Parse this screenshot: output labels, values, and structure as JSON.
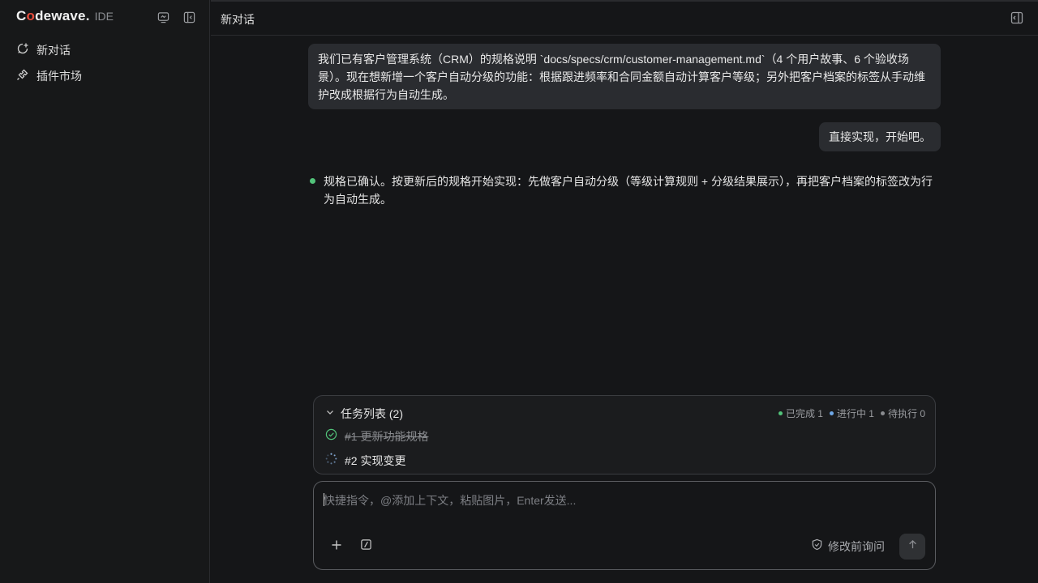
{
  "app": {
    "logo_text_pre": "C",
    "logo_text_o": "o",
    "logo_text_post": "dewave.",
    "logo_suffix": "IDE"
  },
  "sidebar": {
    "items": [
      {
        "label": "新对话",
        "icon": "new-chat-icon"
      },
      {
        "label": "插件市场",
        "icon": "plugin-icon"
      }
    ]
  },
  "header": {
    "title": "新对话"
  },
  "messages": {
    "user1": "我们已有客户管理系统（CRM）的规格说明 `docs/specs/crm/customer-management.md`（4 个用户故事、6 个验收场景）。现在想新增一个客户自动分级的功能：根据跟进频率和合同金额自动计算客户等级；另外把客户档案的标签从手动维护改成根据行为自动生成。",
    "user2": "直接实现，开始吧。",
    "assistant": "规格已确认。按更新后的规格开始实现：先做客户自动分级（等级计算规则 + 分级结果展示），再把客户档案的标签改为行为自动生成。"
  },
  "tasks": {
    "title": "任务列表 (2)",
    "stats": [
      {
        "label": "已完成 1",
        "color": "#52c37a"
      },
      {
        "label": "进行中 1",
        "color": "#6fa8e8"
      },
      {
        "label": "待执行 0",
        "color": "#8a8c90"
      }
    ],
    "items": [
      {
        "label": "#1 更新功能规格",
        "status": "done"
      },
      {
        "label": "#2 实现变更",
        "status": "in-progress"
      }
    ]
  },
  "composer": {
    "placeholder": "快捷指令，@添加上下文，粘贴图片，Enter发送...",
    "confirm_label": "修改前询问"
  },
  "colors": {
    "accent_green": "#52c37a",
    "brand_red": "#e84d3d"
  }
}
